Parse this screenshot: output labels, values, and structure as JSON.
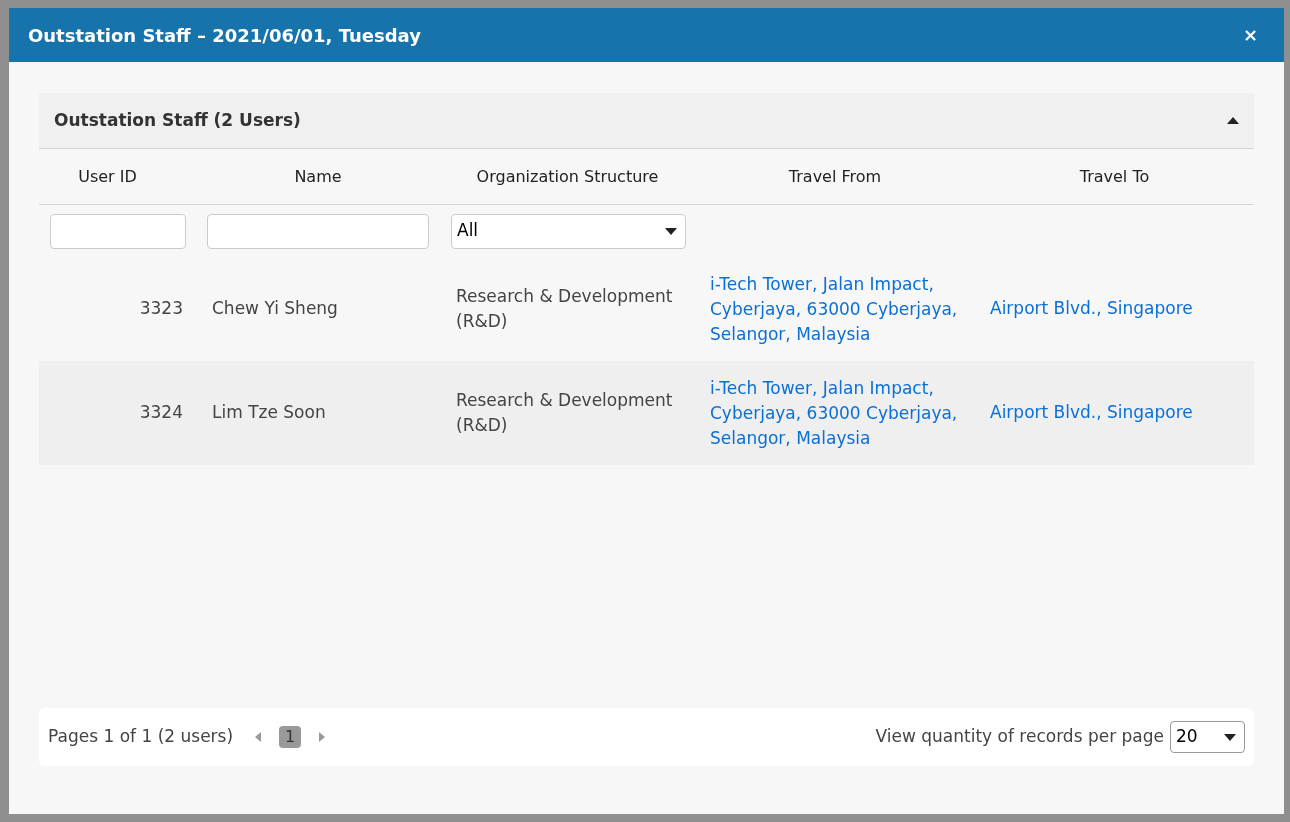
{
  "dialog": {
    "title": "Outstation Staff – 2021/06/01, Tuesday",
    "close": "×"
  },
  "panel": {
    "title": "Outstation Staff (2 Users)",
    "expanded": true
  },
  "table": {
    "columns": [
      "User ID",
      "Name",
      "Organization Structure",
      "Travel From",
      "Travel To"
    ],
    "filters": {
      "organization": {
        "value": "All"
      }
    },
    "rows": [
      {
        "user_id": "3323",
        "name": "Chew Yi Sheng",
        "organization": "Research & Development (R&D)",
        "travel_from": "i-Tech Tower, Jalan Impact, Cyberjaya, 63000 Cyberjaya, Selangor, Malaysia",
        "travel_to": "Airport Blvd., Singapore"
      },
      {
        "user_id": "3324",
        "name": "Lim Tze Soon",
        "organization": "Research & Development (R&D)",
        "travel_from": "i-Tech Tower, Jalan Impact, Cyberjaya, 63000 Cyberjaya, Selangor, Malaysia",
        "travel_to": "Airport Blvd., Singapore"
      }
    ]
  },
  "pagination": {
    "summary": "Pages 1 of 1 (2 users)",
    "pages": [
      {
        "label": "1",
        "selected": true
      }
    ],
    "per_page_label": "View quantity of records per page",
    "per_page": "20"
  }
}
